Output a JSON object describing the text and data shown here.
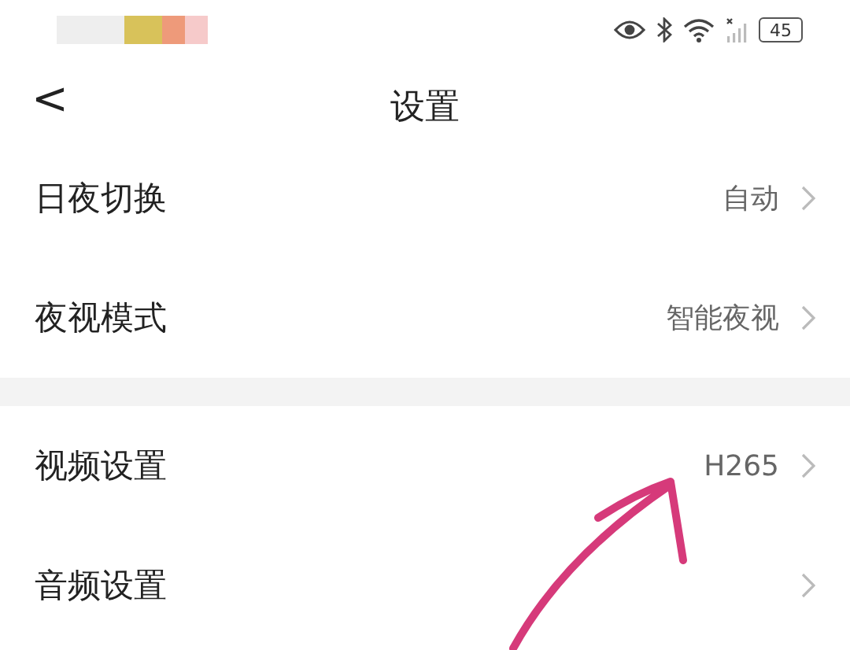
{
  "status_bar": {
    "battery": "45"
  },
  "header": {
    "back": "<",
    "title": "设置"
  },
  "groups": [
    {
      "items": [
        {
          "label": "日夜切换",
          "value": "自动"
        },
        {
          "label": "夜视模式",
          "value": "智能夜视"
        }
      ]
    },
    {
      "items": [
        {
          "label": "视频设置",
          "value": "H265"
        },
        {
          "label": "音频设置"
        }
      ]
    }
  ]
}
